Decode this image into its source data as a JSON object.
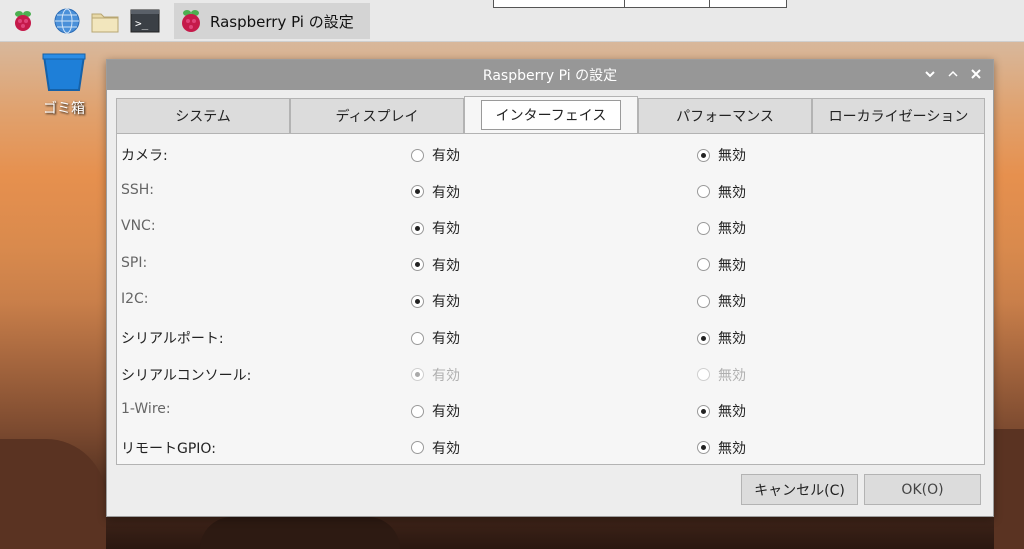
{
  "taskbar": {
    "task_title": "Raspberry Pi の設定",
    "icons": [
      "raspberry-menu-icon",
      "web-browser-icon",
      "file-manager-icon",
      "terminal-icon"
    ]
  },
  "desktop": {
    "trash_label": "ゴミ箱"
  },
  "dialog": {
    "title": "Raspberry Pi の設定",
    "controls": [
      "v",
      "^",
      "×"
    ],
    "tabs": [
      {
        "label": "システム"
      },
      {
        "label": "ディスプレイ"
      },
      {
        "label": "インターフェイス"
      },
      {
        "label": "パフォーマンス"
      },
      {
        "label": "ローカライゼーション"
      }
    ],
    "active_tab": "インターフェイス",
    "option_enable": "有効",
    "option_disable": "無効",
    "rows": [
      {
        "label": "カメラ:",
        "enabled": false,
        "disabled_row": false
      },
      {
        "label": "SSH:",
        "enabled": true,
        "disabled_row": false
      },
      {
        "label": "VNC:",
        "enabled": true,
        "disabled_row": false
      },
      {
        "label": "SPI:",
        "enabled": true,
        "disabled_row": false
      },
      {
        "label": "I2C:",
        "enabled": true,
        "disabled_row": false
      },
      {
        "label": "シリアルポート:",
        "enabled": false,
        "disabled_row": false
      },
      {
        "label": "シリアルコンソール:",
        "enabled": true,
        "disabled_row": true
      },
      {
        "label": "1-Wire:",
        "enabled": false,
        "disabled_row": false
      },
      {
        "label": "リモートGPIO:",
        "enabled": false,
        "disabled_row": false
      }
    ],
    "cancel_label": "キャンセル(C)",
    "ok_label": "OK(O)"
  }
}
